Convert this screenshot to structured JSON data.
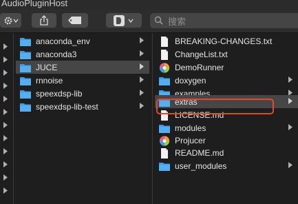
{
  "window": {
    "title": "AudioPluginHost"
  },
  "toolbar": {
    "settings_icon": "gear-icon",
    "share_icon": "share-icon",
    "tag_icon": "tag-icon",
    "app_icon": "app-icon",
    "search_placeholder": "搜索"
  },
  "column2": {
    "items": [
      {
        "label": "anaconda_env",
        "icon": "folder-icon",
        "has_children": true,
        "selected": false
      },
      {
        "label": "anaconda3",
        "icon": "folder-icon",
        "has_children": true,
        "selected": false
      },
      {
        "label": "JUCE",
        "icon": "folder-icon",
        "has_children": true,
        "selected": true
      },
      {
        "label": "rnnoise",
        "icon": "folder-icon",
        "has_children": true,
        "selected": false
      },
      {
        "label": "speexdsp-lib",
        "icon": "folder-icon",
        "has_children": true,
        "selected": false
      },
      {
        "label": "speexdsp-lib-test",
        "icon": "folder-icon",
        "has_children": true,
        "selected": false
      }
    ]
  },
  "column3": {
    "items": [
      {
        "label": "BREAKING-CHANGES.txt",
        "icon": "document-icon",
        "has_children": false,
        "selected": false
      },
      {
        "label": "ChangeList.txt",
        "icon": "document-icon",
        "has_children": false,
        "selected": false
      },
      {
        "label": "DemoRunner",
        "icon": "app-icon",
        "has_children": false,
        "selected": false
      },
      {
        "label": "doxygen",
        "icon": "folder-icon",
        "has_children": true,
        "selected": false
      },
      {
        "label": "examples",
        "icon": "folder-icon",
        "has_children": true,
        "selected": false
      },
      {
        "label": "extras",
        "icon": "folder-icon",
        "has_children": true,
        "selected": true
      },
      {
        "label": "LICENSE.md",
        "icon": "document-icon",
        "has_children": false,
        "selected": false
      },
      {
        "label": "modules",
        "icon": "folder-icon",
        "has_children": true,
        "selected": false
      },
      {
        "label": "Projucer",
        "icon": "app-icon",
        "has_children": false,
        "selected": false,
        "highlighted": true
      },
      {
        "label": "README.md",
        "icon": "document-icon",
        "has_children": false,
        "selected": false
      },
      {
        "label": "user_modules",
        "icon": "folder-icon",
        "has_children": true,
        "selected": false
      }
    ]
  },
  "colors": {
    "folder": "#3d9ee8",
    "highlight_box": "#e8472b",
    "selected_row": "#464646"
  }
}
